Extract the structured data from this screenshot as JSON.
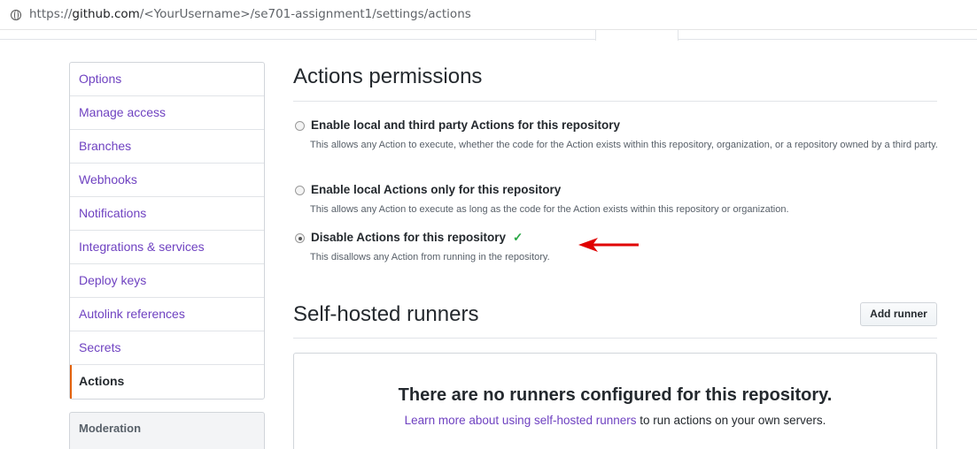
{
  "browser": {
    "url_prefix": "https://",
    "url_domain": "github.com",
    "url_path": "/<YourUsername>/se701-assignment1/settings/actions"
  },
  "sidebar": {
    "items": [
      {
        "label": "Options"
      },
      {
        "label": "Manage access"
      },
      {
        "label": "Branches"
      },
      {
        "label": "Webhooks"
      },
      {
        "label": "Notifications"
      },
      {
        "label": "Integrations & services"
      },
      {
        "label": "Deploy keys"
      },
      {
        "label": "Autolink references"
      },
      {
        "label": "Secrets"
      },
      {
        "label": "Actions",
        "selected": true
      }
    ],
    "section2_header": "Moderation"
  },
  "permissions": {
    "title": "Actions permissions",
    "options": [
      {
        "label": "Enable local and third party Actions for this repository",
        "note": "This allows any Action to execute, whether the code for the Action exists within this repository, organization, or a repository owned by a third party.",
        "checked": false
      },
      {
        "label": "Enable local Actions only for this repository",
        "note": "This allows any Action to execute as long as the code for the Action exists within this repository or organization.",
        "checked": false
      },
      {
        "label": "Disable Actions for this repository",
        "note": "This disallows any Action from running in the repository.",
        "checked": true,
        "saved_mark": "✓"
      }
    ]
  },
  "runners": {
    "title": "Self-hosted runners",
    "add_button": "Add runner",
    "empty_title": "There are no runners configured for this repository.",
    "empty_link": "Learn more about using self-hosted runners",
    "empty_suffix": " to run actions on your own servers."
  },
  "colors": {
    "link": "#6f42c1",
    "selected_accent": "#e36209",
    "check": "#28a745",
    "annotation_arrow": "#e00000"
  }
}
